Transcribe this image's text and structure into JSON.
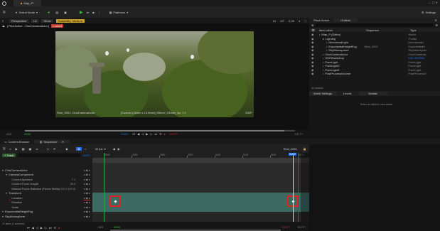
{
  "window": {
    "tab_title": "Map_P*"
  },
  "toolbar": {
    "select_mode": "Select Mode",
    "platforms": "Platforms",
    "settings": "Settings"
  },
  "viewport": {
    "perspective": "Perspective",
    "lit": "Lit",
    "show": "Show",
    "scalability": "Scalability: Medium",
    "pilot_label": "[ Pilot Active - CineCameraActor ]",
    "pilot_badge": "Locked",
    "shot_caption": "Shot_0001: CineCameraActor",
    "lens_caption": "[Custom (16mm x 13.5mm)] 35mm | 23mm | Av: 7.2",
    "frame_counter": "0152*",
    "start_frame": "-015",
    "in_frame": "0000",
    "current_frame": "0152*",
    "end_frame": "0177+",
    "out_frame": "0177+",
    "grid_values": [
      "10",
      "10°",
      "0.25",
      "4"
    ]
  },
  "outliner": {
    "tab_place_actors": "Place Actors",
    "tab_outliner": "Outliner",
    "col_item_label": "Item Label",
    "col_sequence": "Sequence",
    "col_type": "Type",
    "items": [
      {
        "label": "Map_P (Editor)",
        "seq": "",
        "type": "World",
        "indent": 0
      },
      {
        "label": "Lighting",
        "seq": "",
        "type": "Folder",
        "indent": 1
      },
      {
        "label": "DirectionalLight",
        "seq": "",
        "type": "DirectionalLi",
        "indent": 2
      },
      {
        "label": "ExponentialHeightFog",
        "seq": "Shot_0001",
        "type": "ExponentialH",
        "indent": 2
      },
      {
        "label": "SkyAtmosphere",
        "seq": "",
        "type": "SkyAtmospher",
        "indent": 2
      },
      {
        "label": "CineCameraActor",
        "seq": "",
        "type": "CineCameraA",
        "indent": 1
      },
      {
        "label": "HDRIBackdrop",
        "seq": "",
        "type": "Edit HDRIBa",
        "indent": 1
      },
      {
        "label": "PointLight",
        "seq": "",
        "type": "PointLight",
        "indent": 1
      },
      {
        "label": "PointLight2",
        "seq": "",
        "type": "PointLight",
        "indent": 1
      },
      {
        "label": "PointLight3",
        "seq": "",
        "type": "PointLight",
        "indent": 1
      },
      {
        "label": "PostProcessVolume",
        "seq": "",
        "type": "PostProcessV",
        "indent": 1
      }
    ],
    "actor_count": "22 actors"
  },
  "details": {
    "tab_world_settings": "World Settings",
    "tab_levels": "Levels",
    "tab_details": "Details",
    "empty_message": "Select an object to view details."
  },
  "sequencer": {
    "tab_content_browser": "Content Browser",
    "tab_sequencer": "Sequencer",
    "fps": "30 fps",
    "shot_name": "Shot_0001",
    "track_button": "+ Track",
    "search_placeholder": "Search Tracks",
    "current_frame": "0152*",
    "current_frame_field": "0152*",
    "ruler_ticks": [
      "0000",
      "0025",
      "0050",
      "0075",
      "0100",
      "0125",
      "0150",
      "0175"
    ],
    "tracks": [
      {
        "label": "CineCameraActor",
        "value": "",
        "indent": 0
      },
      {
        "label": "CameraComponent",
        "value": "",
        "indent": 1
      },
      {
        "label": "Current Aperture",
        "value": "7.2",
        "indent": 2
      },
      {
        "label": "Current Focal Length",
        "value": "35.0",
        "indent": 2
      },
      {
        "label": "Manual Focus Distance (Focus Settings)",
        "value": "100.0 (00:0)",
        "indent": 2
      },
      {
        "label": "Transform",
        "value": "",
        "indent": 1
      },
      {
        "label": "Location",
        "value": "",
        "indent": 2
      },
      {
        "label": "Rotation",
        "value": "",
        "indent": 2
      },
      {
        "label": "Scale",
        "value": "",
        "indent": 2
      },
      {
        "label": "ExponentialHeightFog",
        "value": "",
        "indent": 0
      },
      {
        "label": "SkyAtmosphere",
        "value": "",
        "indent": 0
      }
    ],
    "items_status": "22 items (1 selected)",
    "bottom_start": "-015",
    "bottom_in": "0000",
    "bottom_end": "0177+",
    "bottom_out": "0177+"
  },
  "colors": {
    "accent_blue": "#1a73e8",
    "play_green": "#3fbf3f",
    "keyframe_red": "#e02020",
    "transform_track": "#3b6a63"
  }
}
